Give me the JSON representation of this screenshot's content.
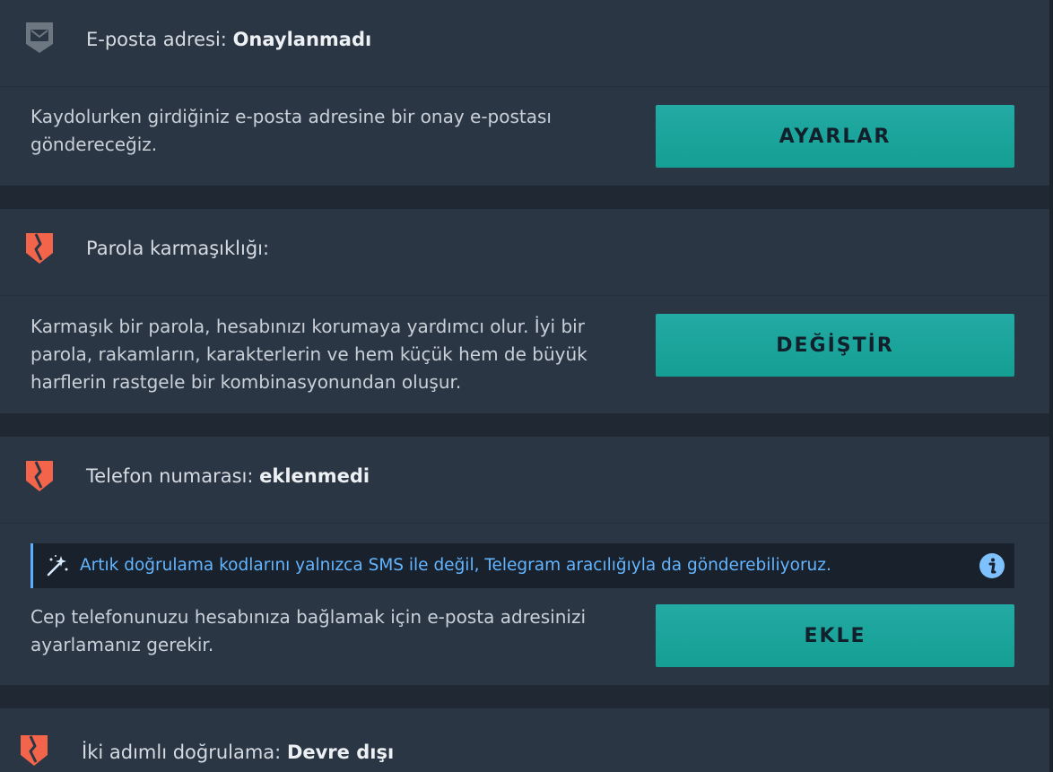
{
  "email_section": {
    "title_prefix": "E-posta adresi: ",
    "title_value": "Onaylanmadı",
    "description": "Kaydolurken girdiğiniz e-posta adresine bir onay e-postası göndereceğiz.",
    "button_label": "AYARLAR"
  },
  "password_section": {
    "title_prefix": "Parola karmaşıklığı:",
    "description": "Karmaşık bir parola, hesabınızı korumaya yardımcı olur. İyi bir parola, rakamların, karakterlerin ve hem küçük hem de büyük harflerin rastgele bir kombinasyonundan oluşur.",
    "button_label": "DEĞİŞTİR"
  },
  "phone_section": {
    "title_prefix": "Telefon numarası: ",
    "title_value": "eklenmedi",
    "notice": "Artık doğrulama kodlarını yalnızca SMS ile değil, Telegram aracılığıyla da gönderebiliyoruz.",
    "description": "Cep telefonunuzu hesabınıza bağlamak için e-posta adresinizi ayarlamanız gerekir.",
    "button_label": "EKLE"
  },
  "two_factor_section": {
    "title_prefix": "İki adımlı doğrulama: ",
    "title_value": "Devre dışı"
  },
  "colors": {
    "background": "#1f2833",
    "card": "#2b3645",
    "button_teal": "#1aa59d",
    "warning_shield": "#f3654a",
    "neutral_shield": "#6d7782",
    "notice_text": "#64b5ff"
  },
  "icons": {
    "email_status": "mail-shield-icon",
    "warning_status": "broken-shield-icon",
    "notice": "magic-wand-icon",
    "info": "info-icon"
  }
}
